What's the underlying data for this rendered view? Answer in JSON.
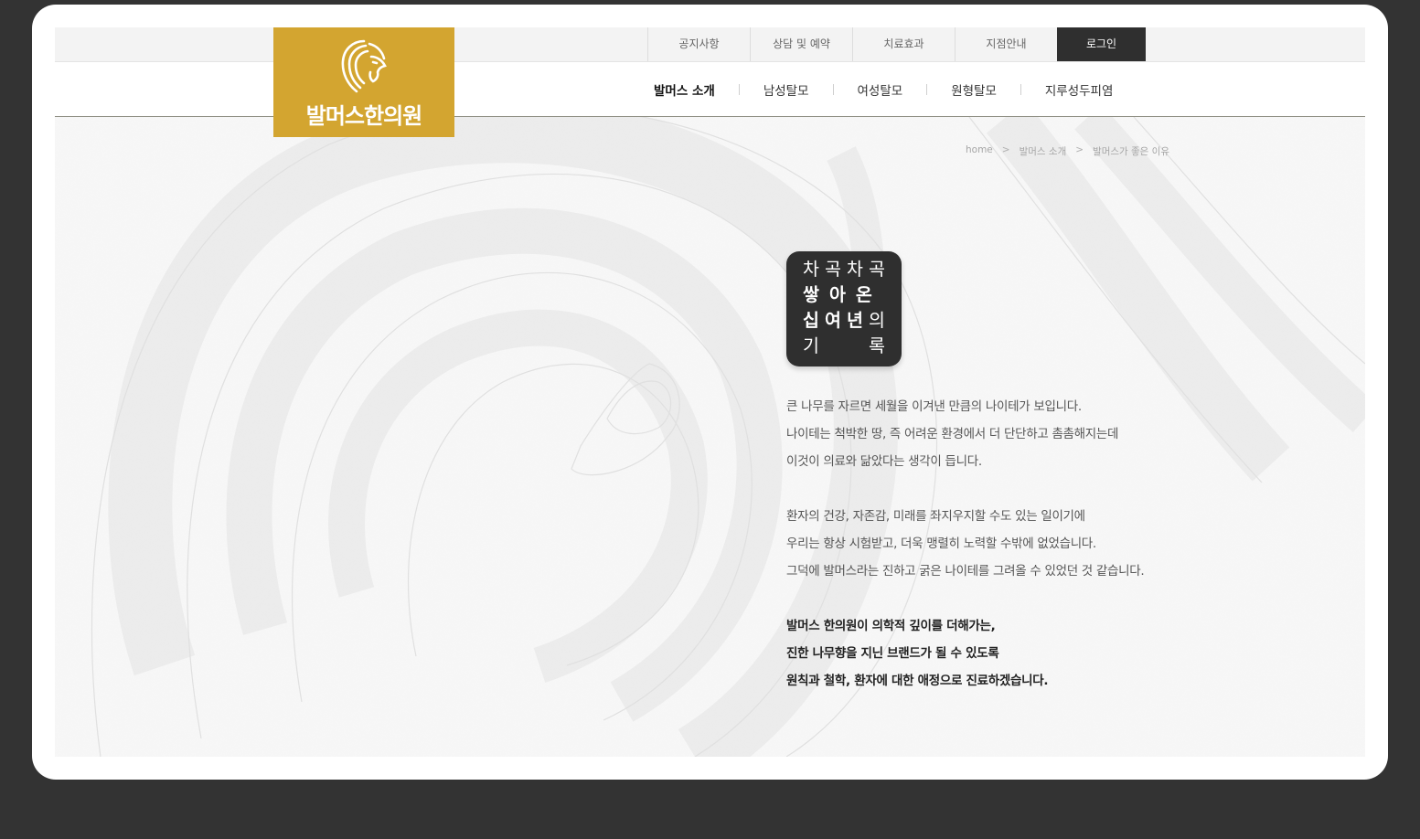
{
  "brand": {
    "name": "발머스한의원",
    "color": "#d3a530",
    "logo_icon": "lion-head-icon"
  },
  "top_nav": [
    {
      "label": "공지사항"
    },
    {
      "label": "상담 및 예약"
    },
    {
      "label": "치료효과"
    },
    {
      "label": "지점안내"
    },
    {
      "label": "로그인"
    }
  ],
  "main_nav": [
    {
      "label": "발머스 소개",
      "active": true
    },
    {
      "label": "남성탈모"
    },
    {
      "label": "여성탈모"
    },
    {
      "label": "원형탈모"
    },
    {
      "label": "지루성두피염"
    }
  ],
  "breadcrumb": [
    "home",
    "발머스 소개",
    "발머스가 좋은 이유"
  ],
  "breadcrumb_sep": ">",
  "badge": {
    "rows": [
      [
        "차",
        "곡",
        "차",
        "곡"
      ],
      [
        "쌓",
        "아",
        "온",
        ""
      ],
      [
        "십",
        "여",
        "년",
        "의"
      ],
      [
        "기",
        "",
        "",
        "록"
      ]
    ]
  },
  "paragraphs": [
    {
      "strong": false,
      "lines": [
        "큰 나무를 자르면 세월을 이겨낸 만큼의 나이테가 보입니다.",
        "나이테는 척박한 땅, 즉 어려운 환경에서 더 단단하고 촘촘해지는데",
        "이것이 의료와 닮았다는 생각이 듭니다."
      ]
    },
    {
      "strong": false,
      "lines": [
        "환자의 건강, 자존감, 미래를 좌지우지할 수도 있는 일이기에",
        "우리는 항상 시험받고, 더욱 맹렬히 노력할 수밖에 없었습니다.",
        "그덕에 발머스라는 진하고 굵은 나이테를 그려올 수 있었던 것 같습니다."
      ]
    },
    {
      "strong": true,
      "lines": [
        "발머스 한의원이 의학적 깊이를 더해가는,",
        "진한 나무향을 지닌 브랜드가 될 수 있도록",
        "원칙과 철학, 환자에 대한 애정으로 진료하겠습니다."
      ]
    }
  ],
  "colors": {
    "background": "#333333",
    "topbar": "#f3f3f3",
    "login_bg": "#2f2f2f",
    "badge_bg": "#2f2f2f"
  }
}
